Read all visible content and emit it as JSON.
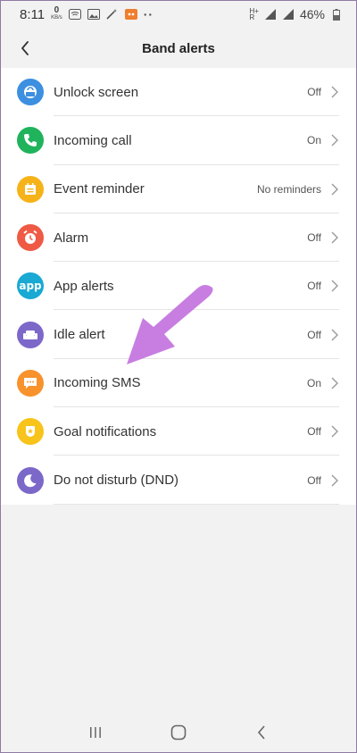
{
  "status_bar": {
    "time": "8:11",
    "kbs_value": "0",
    "kbs_unit": "KB/s",
    "network_label_top": "H+",
    "network_label_bottom": "R",
    "battery_percent": "46%"
  },
  "header": {
    "title": "Band alerts"
  },
  "alerts": [
    {
      "label": "Unlock screen",
      "value": "Off",
      "color": "#3d8fe0",
      "icon": "lock-icon"
    },
    {
      "label": "Incoming call",
      "value": "On",
      "color": "#1fb35c",
      "icon": "phone-icon"
    },
    {
      "label": "Event reminder",
      "value": "No reminders",
      "color": "#f6b319",
      "icon": "calendar-icon"
    },
    {
      "label": "Alarm",
      "value": "Off",
      "color": "#ef5a45",
      "icon": "alarm-clock-icon"
    },
    {
      "label": "App alerts",
      "value": "Off",
      "color": "#19a9d3",
      "icon": "app-icon",
      "icon_text": "app"
    },
    {
      "label": "Idle alert",
      "value": "Off",
      "color": "#7c68c9",
      "icon": "sofa-icon"
    },
    {
      "label": "Incoming SMS",
      "value": "On",
      "color": "#f7922c",
      "icon": "message-icon"
    },
    {
      "label": "Goal notifications",
      "value": "Off",
      "color": "#f8c31a",
      "icon": "trophy-icon"
    },
    {
      "label": "Do not disturb (DND)",
      "value": "Off",
      "color": "#7c68c9",
      "icon": "moon-icon"
    }
  ],
  "colors": {
    "arrow": "#c77ee0",
    "background": "#f2f2f2"
  }
}
